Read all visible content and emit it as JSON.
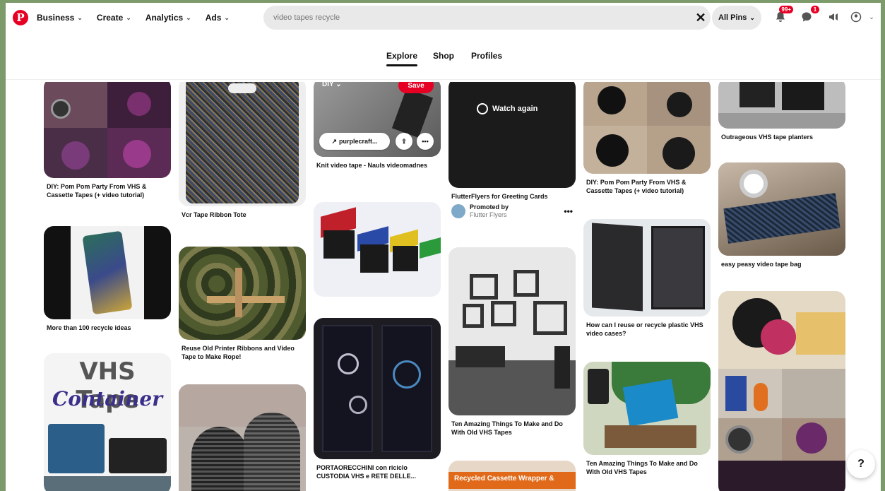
{
  "nav": {
    "logo": "P",
    "business": "Business",
    "create": "Create",
    "analytics": "Analytics",
    "ads": "Ads",
    "chevron": "⌄"
  },
  "search": {
    "query": "video tapes recycle",
    "clear": "✕",
    "filter": "All Pins",
    "filter_chevron": "⌄"
  },
  "header_icons": {
    "notifications_badge": "99+",
    "messages_badge": "1",
    "notifications_icon": "bell-icon",
    "messages_icon": "chat-icon",
    "updates_icon": "megaphone-icon",
    "account_icon": "account-icon"
  },
  "tabs": [
    "Explore",
    "Shop",
    "Profiles"
  ],
  "pins": {
    "c1p1": "DIY: Pom Pom Party From VHS & Cassette Tapes (+ video tutorial)",
    "c1p2": "More than 100 recycle ideas",
    "c1p3_line1": "VHS Tape",
    "c1p3_line2": "Container",
    "c2p1": "Vcr Tape Ribbon Tote",
    "c2p2": "Reuse Old Printer Ribbons and Video Tape to Make Rope!",
    "c3p1": "Knit video tape - Nauls videomadnes",
    "c3p1_source": "purplecraft...",
    "c3p1_board": "DIY",
    "c3p1_save": "Save",
    "c3p2": "PORTAORECCHINI con riciclo CUSTODIA VHS e RETE DELLE...",
    "c4p1_overlay": "Watch again",
    "c4p1": "FlutterFlyers for Greeting Cards",
    "c4p1_promoted": "Promoted by",
    "c4p1_promoter": "Flutter Flyers",
    "c4p1_more": "•••",
    "c4p2": "Ten Amazing Things To Make and Do With Old VHS Tapes",
    "c4p3_banner": "Recycled Cassette Wrapper &",
    "c5p1": "DIY: Pom Pom Party From VHS & Cassette Tapes (+ video tutorial)",
    "c5p2": "How can I reuse or recycle plastic VHS video cases?",
    "c5p3": "Ten Amazing Things To Make and Do With Old VHS Tapes",
    "c6p1": "Outrageous VHS tape planters",
    "c6p2": "easy peasy video tape bag"
  },
  "help": "?"
}
